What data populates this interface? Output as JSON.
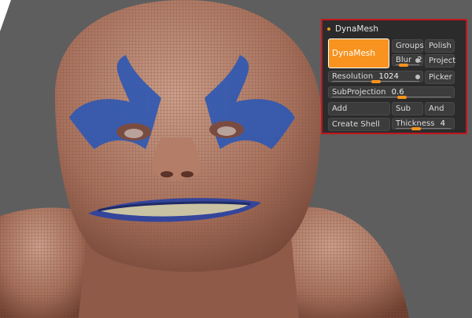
{
  "panel": {
    "title": "DynaMesh",
    "buttons": {
      "dynamesh": "DynaMesh",
      "groups": "Groups",
      "polish": "Polish",
      "project": "Project",
      "picker": "Picker",
      "add": "Add",
      "sub": "Sub",
      "and": "And",
      "create_shell": "Create Shell"
    },
    "sliders": {
      "blur": {
        "label": "Blur",
        "value": "2",
        "level": 0.2
      },
      "resolution": {
        "label": "Resolution",
        "value": "1024",
        "level": 0.5
      },
      "subprojection": {
        "label": "SubProjection",
        "value": "0.6",
        "level": 0.6
      },
      "thickness": {
        "label": "Thickness",
        "value": "4",
        "level": 0.35
      }
    }
  },
  "colors": {
    "accent": "#f7931e",
    "panel_border": "#c4161c",
    "panel_bg": "#2b2b2b",
    "viewport_bg": "#5e5e5e"
  }
}
